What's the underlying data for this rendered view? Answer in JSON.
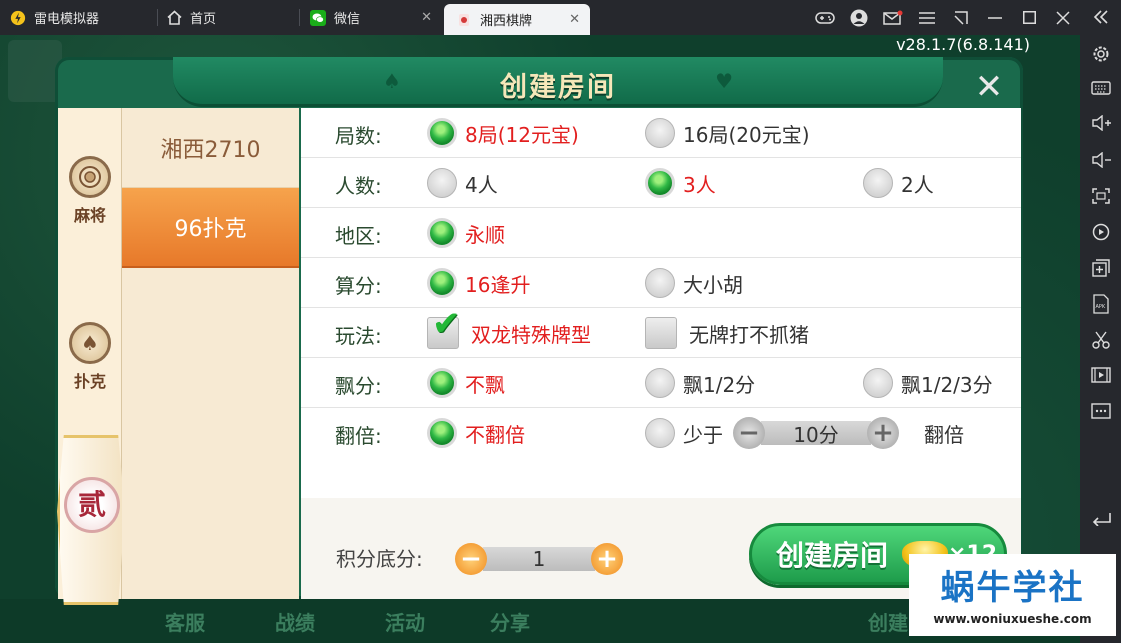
{
  "emulator": {
    "tabs": [
      {
        "label": "雷电模拟器"
      },
      {
        "label": "首页"
      },
      {
        "label": "微信"
      },
      {
        "label": "湘西棋牌"
      }
    ]
  },
  "game": {
    "version": "v28.1.7(6.8.141)",
    "bottom_items": [
      "客服",
      "战绩",
      "活动",
      "分享",
      "创建"
    ]
  },
  "dialog": {
    "title": "创建房间",
    "rail": {
      "mahjong": "麻将",
      "poker": "扑克",
      "seal": "贰"
    },
    "modes": [
      "湘西2710",
      "96扑克"
    ],
    "rows": [
      {
        "label": "局数:",
        "options": [
          "8局(12元宝)",
          "16局(20元宝)"
        ]
      },
      {
        "label": "人数:",
        "options": [
          "4人",
          "3人",
          "2人"
        ]
      },
      {
        "label": "地区:",
        "options": [
          "永顺"
        ]
      },
      {
        "label": "算分:",
        "options": [
          "16逢升",
          "大小胡"
        ]
      },
      {
        "label": "玩法:",
        "options": [
          "双龙特殊牌型",
          "无牌打不抓猪"
        ]
      },
      {
        "label": "飘分:",
        "options": [
          "不飘",
          "飘1/2分",
          "飘1/2/3分"
        ]
      },
      {
        "label": "翻倍:",
        "options": [
          "不翻倍",
          "少于"
        ],
        "stepper_value": "10分",
        "suffix": "翻倍"
      }
    ],
    "footer": {
      "base_label": "积分底分:",
      "base_value": "1",
      "create_label": "创建房间",
      "cost": "×12"
    }
  },
  "watermark": {
    "title": "蜗牛学社",
    "url": "www.woniuxueshe.com"
  }
}
